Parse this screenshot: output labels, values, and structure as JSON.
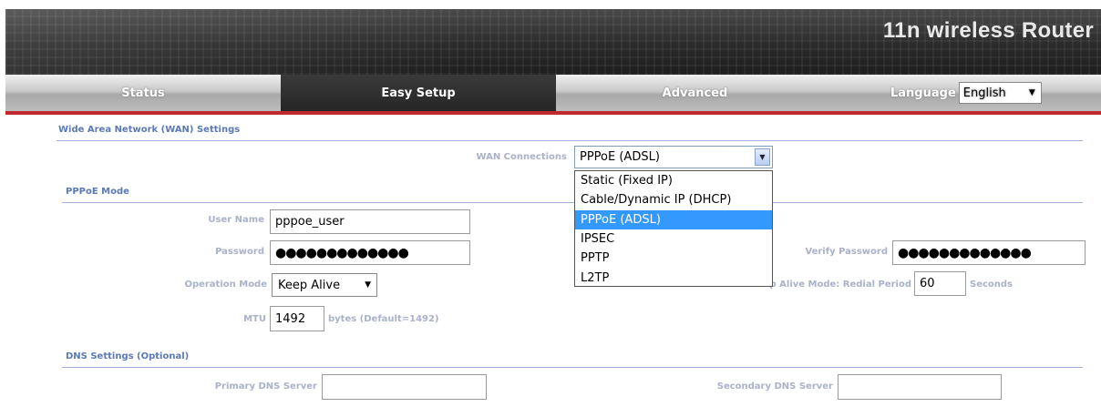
{
  "header": {
    "product_title": "11n wireless Router"
  },
  "nav": {
    "tabs": [
      {
        "label": "Status"
      },
      {
        "label": "Easy Setup"
      },
      {
        "label": "Advanced"
      }
    ],
    "language_label": "Language",
    "language_value": "English"
  },
  "wan": {
    "section_title": "Wide Area Network (WAN) Settings",
    "connections_label": "WAN Connections",
    "connections_value": "PPPoE (ADSL)",
    "options": [
      "Static (Fixed IP)",
      "Cable/Dynamic IP (DHCP)",
      "PPPoE (ADSL)",
      "IPSEC",
      "PPTP",
      "L2TP"
    ],
    "selected_index": 2
  },
  "pppoe": {
    "section_title": "PPPoE Mode",
    "username_label": "User Name",
    "username_value": "pppoe_user",
    "password_label": "Password",
    "password_value": "●●●●●●●●●●●●●",
    "verify_label": "Verify Password",
    "verify_value": "●●●●●●●●●●●●●",
    "operation_label": "Operation Mode",
    "operation_value": "Keep Alive",
    "redial_label": "Keep Alive Mode: Redial Period",
    "redial_value": "60",
    "redial_unit": "Seconds",
    "mtu_label": "MTU",
    "mtu_value": "1492",
    "mtu_hint": "bytes (Default=1492)"
  },
  "dns": {
    "section_title": "DNS Settings (Optional)",
    "primary_label": "Primary DNS Server",
    "primary_value": "",
    "secondary_label": "Secondary DNS Server",
    "secondary_value": ""
  },
  "colors": {
    "accent_red": "#c0282e",
    "section_blue": "#5a79b8",
    "highlight": "#3399ff"
  }
}
